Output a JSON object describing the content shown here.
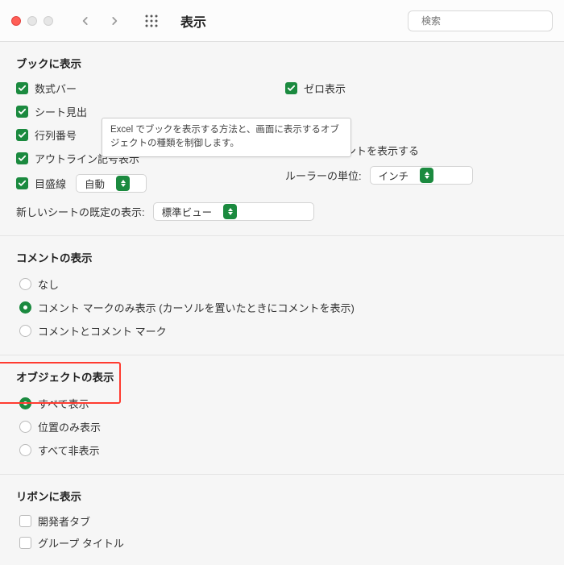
{
  "titlebar": {
    "title": "表示",
    "search_placeholder": "検索"
  },
  "tooltip": "Excel でブックを表示する方法と、画面に表示するオブジェクトの種類を制御します。",
  "sections": {
    "book": {
      "title": "ブックに表示",
      "formula_bar": "数式バー",
      "sheet_tabs": "シート見出",
      "row_col_headers": "行列番号",
      "outline_symbols": "アウトライン記号表示",
      "gridlines": "目盛線",
      "gridlines_select": "自動",
      "zero_values": "ゼロ表示",
      "function_hints": "関数のヒントを表示する",
      "ruler_label": "ルーラーの単位:",
      "ruler_select": "インチ",
      "new_sheet_label": "新しいシートの既定の表示:",
      "new_sheet_select": "標準ビュー"
    },
    "comments": {
      "title": "コメントの表示",
      "none": "なし",
      "marks_only": "コメント マークのみ表示 (カーソルを置いたときにコメントを表示)",
      "comments_and_marks": "コメントとコメント マーク"
    },
    "objects": {
      "title": "オブジェクトの表示",
      "show_all": "すべて表示",
      "placeholders": "位置のみ表示",
      "hide_all": "すべて非表示"
    },
    "ribbon": {
      "title": "リボンに表示",
      "developer": "開発者タブ",
      "group_titles": "グループ タイトル"
    }
  }
}
